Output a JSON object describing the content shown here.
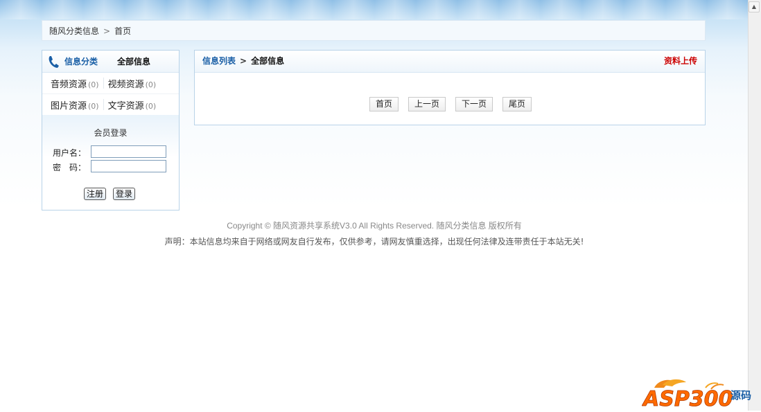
{
  "breadcrumb": {
    "site": "随风分类信息",
    "separator": ">",
    "current": "首页"
  },
  "sidebar": {
    "header_category": "信息分类",
    "header_all": "全部信息",
    "categories": [
      {
        "label": "音频资源",
        "count": "(0)"
      },
      {
        "label": "视频资源",
        "count": "(0)"
      },
      {
        "label": "图片资源",
        "count": "(0)"
      },
      {
        "label": "文字资源",
        "count": "(0)"
      }
    ]
  },
  "login": {
    "title": "会员登录",
    "username_label": "用户名：",
    "password_label": "密　码：",
    "username_value": "",
    "password_value": "",
    "register_button": "注册",
    "login_button": "登录"
  },
  "main": {
    "list_label": "信息列表",
    "arrow": ">",
    "current_label": "全部信息",
    "upload_link": "资料上传",
    "pager": [
      "首页",
      "上一页",
      "下一页",
      "尾页"
    ]
  },
  "footer": {
    "copyright": "Copyright © 随风资源共享系统V3.0 All Rights Reserved. 随风分类信息 版权所有",
    "declaration": "声明：本站信息均来自于网络或网友自行发布，仅供参考，请网友慎重选择，出现任何法律及连带责任于本站无关!"
  },
  "watermark": {
    "brand": "ASP300",
    "suffix": "源码"
  },
  "colors": {
    "accent_blue": "#1a5fa6",
    "upload_red": "#cc0000",
    "panel_border": "#b9d3e8"
  }
}
